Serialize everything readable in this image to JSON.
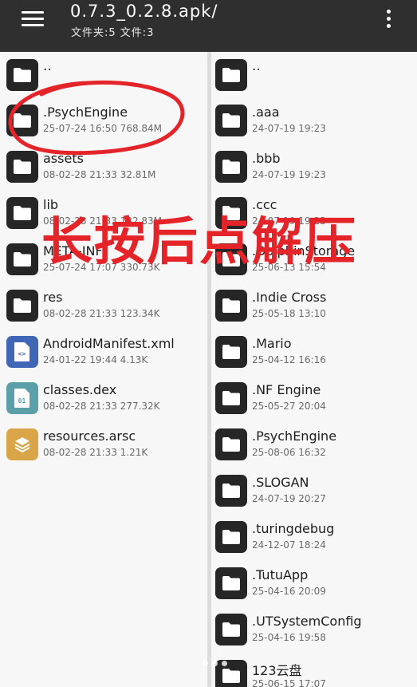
{
  "toolbar": {
    "title": "0.7.3_0.2.8.apk/",
    "subtitle": "文件夹:5 文件:3",
    "menu_icon": "hamburger-menu-icon",
    "more_icon": "more-vertical-icon"
  },
  "left_panel": {
    "items": [
      {
        "name": "..",
        "meta": "",
        "type": "folder"
      },
      {
        "name": ".PsychEngine",
        "meta": "25-07-24 16:50  768.84M",
        "type": "folder"
      },
      {
        "name": "assets",
        "meta": "08-02-28 21:33  32.81M",
        "type": "folder"
      },
      {
        "name": "lib",
        "meta": "08-02-28 21:33  132.83M",
        "type": "folder"
      },
      {
        "name": "META-INF",
        "meta": "25-07-24 17:07  330.73K",
        "type": "folder"
      },
      {
        "name": "res",
        "meta": "08-02-28 21:33  123.34K",
        "type": "folder"
      },
      {
        "name": "AndroidManifest.xml",
        "meta": "24-01-22 19:44  4.13K",
        "type": "xml"
      },
      {
        "name": "classes.dex",
        "meta": "08-02-28 21:33  277.32K",
        "type": "dex"
      },
      {
        "name": "resources.arsc",
        "meta": "08-02-28 21:33  1.21K",
        "type": "arsc"
      }
    ]
  },
  "right_panel": {
    "items": [
      {
        "name": "..",
        "meta": ""
      },
      {
        "name": ".aaa",
        "meta": "24-07-19 19:23"
      },
      {
        "name": ".bbb",
        "meta": "24-07-19 19:23"
      },
      {
        "name": ".ccc",
        "meta": "24-07-19 19:23"
      },
      {
        "name": ".DolphinStorage",
        "meta": "25-06-13 15:54"
      },
      {
        "name": ".Indie Cross",
        "meta": "25-05-18 13:10"
      },
      {
        "name": ".Mario",
        "meta": "25-04-12 16:16"
      },
      {
        "name": ".NF Engine",
        "meta": "25-05-27 20:04"
      },
      {
        "name": ".PsychEngine",
        "meta": "25-08-06 16:32"
      },
      {
        "name": ".SLOGAN",
        "meta": "24-07-19 20:27"
      },
      {
        "name": ".turingdebug",
        "meta": "24-12-07 18:24"
      },
      {
        "name": ".TutuApp",
        "meta": "25-04-16 20:09"
      },
      {
        "name": ".UTSystemConfig",
        "meta": "25-04-16 19:58"
      },
      {
        "name": "123云盘",
        "meta": "25-06-15 17:07"
      }
    ]
  },
  "overlay": {
    "caption": "长按后点解压",
    "caption_color": "#e5242a"
  },
  "colors": {
    "toolbar_bg": "#2f2f2f",
    "folder_icon_bg": "#262626",
    "xml_icon_bg": "#3f67b5",
    "dex_icon_bg": "#5ba0a8",
    "arsc_icon_bg": "#d9a548",
    "annotation_red": "#e5242a"
  }
}
